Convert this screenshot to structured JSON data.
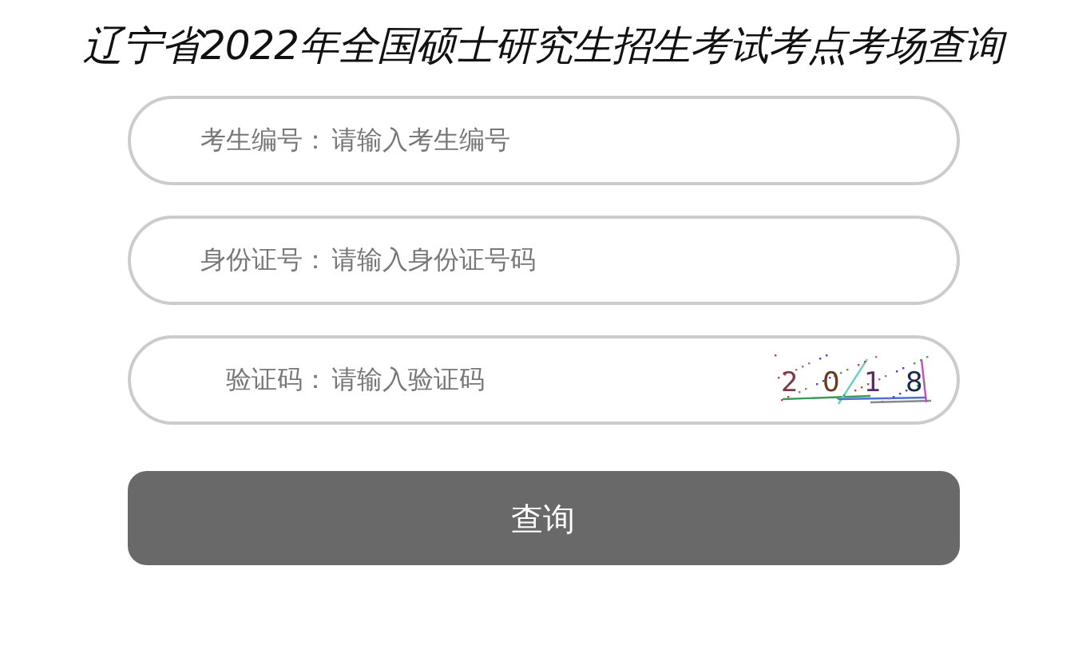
{
  "title": "辽宁省2022年全国硕士研究生招生考试考点考场查询",
  "fields": [
    {
      "label": "考生编号：",
      "placeholder": "请输入考生编号",
      "kind": "text"
    },
    {
      "label": "身份证号：",
      "placeholder": "请输入身份证号码",
      "kind": "text"
    },
    {
      "label": "验证码：",
      "placeholder": "请输入验证码",
      "kind": "captcha",
      "captcha": [
        "2",
        "0",
        "1",
        "8"
      ]
    }
  ],
  "button": "查询"
}
